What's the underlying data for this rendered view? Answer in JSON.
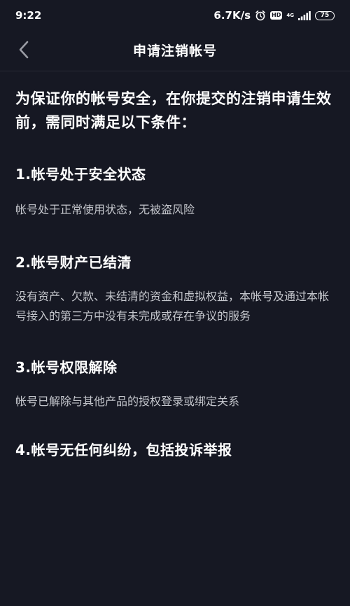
{
  "status_bar": {
    "time": "9:22",
    "net_speed": "6.7K/s",
    "hd": "HD",
    "network_type": "4G",
    "battery": "75",
    "icons": [
      "alarm-icon",
      "hd-icon",
      "signal-icon",
      "battery-icon"
    ]
  },
  "nav": {
    "back_icon": "chevron-left-icon",
    "title": "申请注销帐号"
  },
  "content": {
    "intro": "为保证你的帐号安全，在你提交的注销申请生效前，需同时满足以下条件：",
    "sections": [
      {
        "heading": "1.帐号处于安全状态",
        "body": "帐号处于正常使用状态，无被盗风险"
      },
      {
        "heading": "2.帐号财产已结清",
        "body": "没有资产、欠款、未结清的资金和虚拟权益，本帐号及通过本帐号接入的第三方中没有未完成或存在争议的服务"
      },
      {
        "heading": "3.帐号权限解除",
        "body": "帐号已解除与其他产品的授权登录或绑定关系"
      },
      {
        "heading": "4.帐号无任何纠纷，包括投诉举报",
        "body": ""
      }
    ]
  },
  "colors": {
    "background": "#161823",
    "text_primary": "#ffffff",
    "text_secondary": "#c4c6cc",
    "divider": "#2a2c36"
  }
}
